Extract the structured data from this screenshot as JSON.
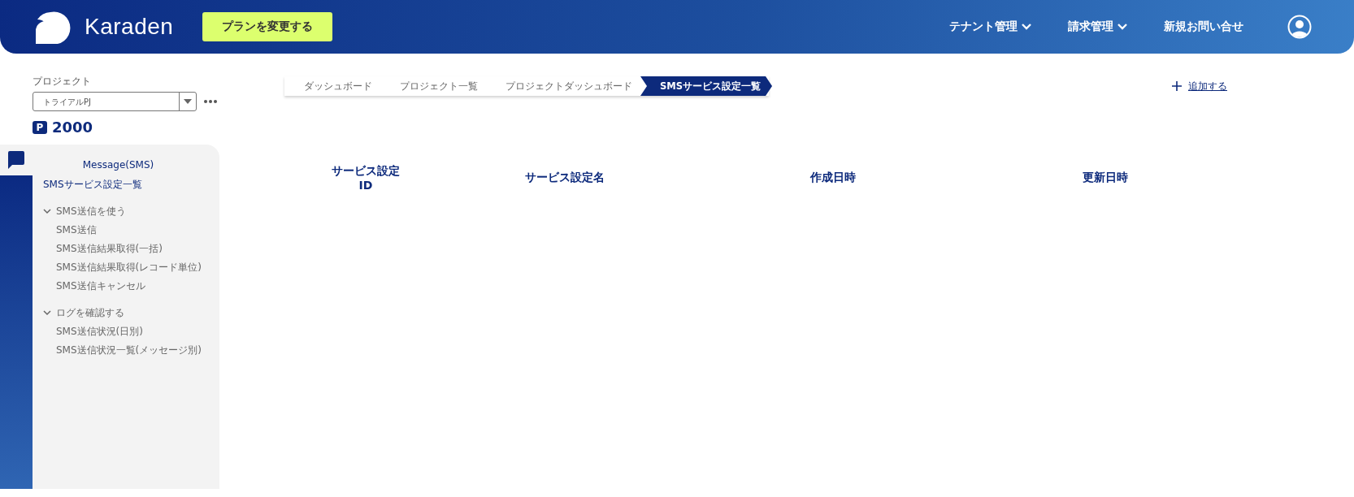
{
  "header": {
    "brand": "Karaden",
    "plan_button": "プランを変更する",
    "nav": [
      {
        "label": "テナント管理",
        "dropdown": true
      },
      {
        "label": "請求管理",
        "dropdown": true
      },
      {
        "label": "新規お問い合せ",
        "dropdown": false
      }
    ]
  },
  "project": {
    "label": "プロジェクト",
    "value": "トライアルPJ",
    "points_badge": "P",
    "points": "2000"
  },
  "sidebar": {
    "title": "Message(SMS)",
    "items": [
      {
        "label": "SMSサービス設定一覧",
        "selected": true
      },
      {
        "label": "SMS送信を使う",
        "expanded": true,
        "children": [
          {
            "label": "SMS送信",
            "selected": false
          },
          {
            "label": "SMS送信結果取得(一括)",
            "selected": false
          },
          {
            "label": "SMS送信結果取得(レコード単位)",
            "selected": false
          },
          {
            "label": "SMS送信キャンセル",
            "selected": false
          }
        ]
      },
      {
        "label": "ログを確認する",
        "expanded": true,
        "children": [
          {
            "label": "SMS送信状況(日別)",
            "selected": false
          },
          {
            "label": "SMS送信状況一覧(メッセージ別)",
            "selected": false
          }
        ]
      }
    ]
  },
  "breadcrumb": [
    {
      "label": "ダッシュボード",
      "selected": false
    },
    {
      "label": "プロジェクト一覧",
      "selected": false
    },
    {
      "label": "プロジェクトダッシュボード",
      "selected": false
    },
    {
      "label": "SMSサービス設定一覧",
      "selected": true
    }
  ],
  "add_link": "追加する",
  "table": {
    "columns": [
      "サービス設定\nID",
      "サービス設定名",
      "作成日時",
      "更新日時"
    ]
  }
}
